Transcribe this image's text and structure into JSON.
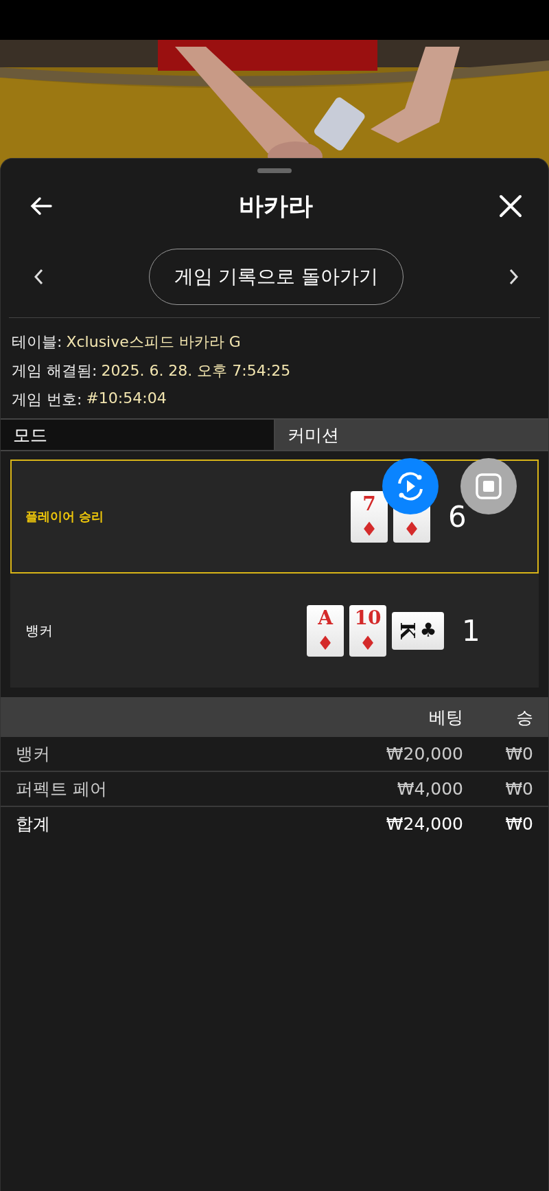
{
  "header": {
    "title": "바카라"
  },
  "nav": {
    "back_to_history": "게임 기록으로 돌아가기"
  },
  "info": [
    {
      "label": "테이블:",
      "value": "Xclusive스피드 바카라 G"
    },
    {
      "label": "게임 해결됨:",
      "value": "2025. 6. 28. 오후 7:54:25"
    },
    {
      "label": "게임 번호:",
      "value": "#10:54:04"
    }
  ],
  "tabs": [
    {
      "label": "모드",
      "selected": true
    },
    {
      "label": "커미션",
      "selected": false
    }
  ],
  "hands": [
    {
      "label": "플레이어 승리",
      "winner": true,
      "score": "6",
      "cards": [
        {
          "rank": "7",
          "suit": "♦",
          "color": "#d42a2a",
          "sideways": false
        },
        {
          "suit": "♦",
          "color": "#d42a2a",
          "sideways": false
        }
      ]
    },
    {
      "label": "뱅커",
      "winner": false,
      "score": "1",
      "cards": [
        {
          "rank": "A",
          "suit": "♦",
          "color": "#d42a2a",
          "sideways": false
        },
        {
          "rank": "10",
          "suit": "♦",
          "color": "#d42a2a",
          "sideways": false
        },
        {
          "rank": "K",
          "suit": "♣",
          "color": "#111111",
          "sideways": true
        }
      ]
    }
  ],
  "bets": {
    "columns": [
      "베팅",
      "승"
    ],
    "rows": [
      {
        "name": "뱅커",
        "bet": "₩20,000",
        "win": "₩0",
        "kind": "item"
      },
      {
        "name": "퍼펙트 페어",
        "bet": "₩4,000",
        "win": "₩0",
        "kind": "item"
      },
      {
        "name": "합계",
        "bet": "₩24,000",
        "win": "₩0",
        "kind": "total"
      }
    ]
  }
}
